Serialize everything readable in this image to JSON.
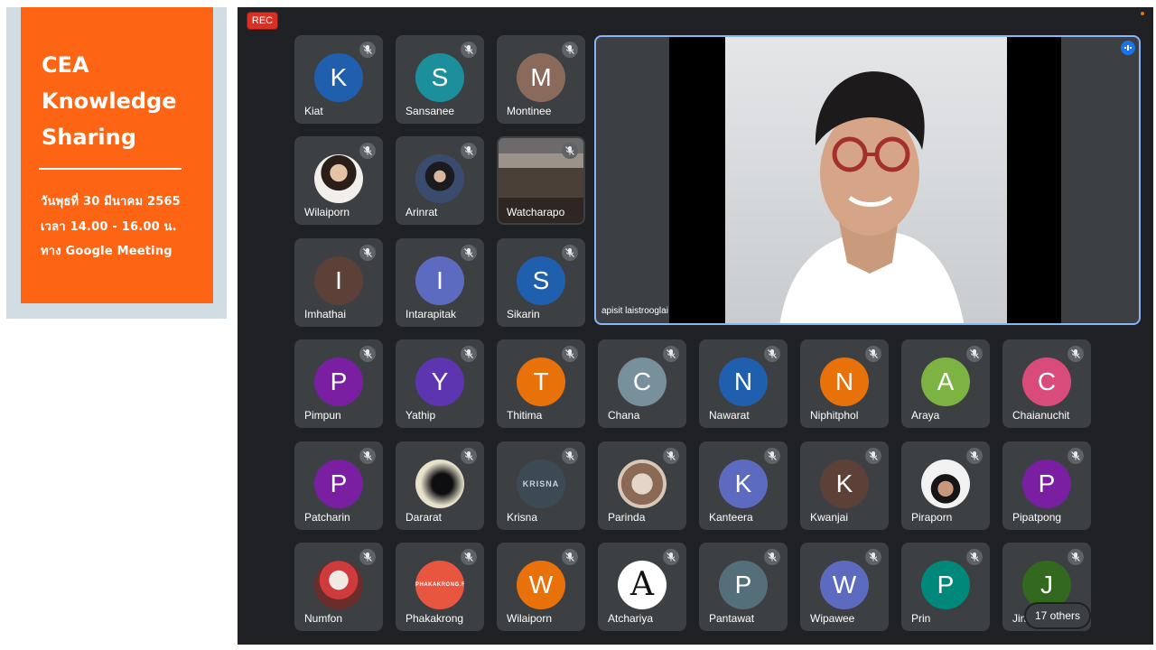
{
  "poster": {
    "title_lines": [
      "CEA",
      "Knowledge",
      "Sharing"
    ],
    "info_lines": [
      "วันพุธที่ 30 มีนาคม 2565",
      "เวลา 14.00 - 16.00 น.",
      "ทาง Google Meeting"
    ],
    "bg_color": "#fd6414"
  },
  "meet": {
    "rec_label": "REC",
    "speaker": {
      "name": "apisit laistrooglai"
    },
    "others_label": "17 others",
    "participants": [
      {
        "name": "Kiat",
        "initial": "K",
        "color": "#1f5fae"
      },
      {
        "name": "Sansanee",
        "initial": "S",
        "color": "#1b8f9c"
      },
      {
        "name": "Montinee",
        "initial": "M",
        "color": "#8a6b5b"
      },
      {
        "name": "Wilaiporn",
        "initial": "",
        "color": "#f2eee9"
      },
      {
        "name": "Arinrat",
        "initial": "",
        "color": "#3a4c6e"
      },
      {
        "name": "Watcharapo",
        "initial": "",
        "color": "#4b4038"
      },
      {
        "name": "Imhathai",
        "initial": "I",
        "color": "#5d4037"
      },
      {
        "name": "Intarapitak",
        "initial": "I",
        "color": "#5c6bc0"
      },
      {
        "name": "Sikarin",
        "initial": "S",
        "color": "#1f5fae"
      },
      {
        "name": "Pimpun",
        "initial": "P",
        "color": "#7b1fa2"
      },
      {
        "name": "Yathip",
        "initial": "Y",
        "color": "#5e35b1"
      },
      {
        "name": "Thitima",
        "initial": "T",
        "color": "#e8710a"
      },
      {
        "name": "Chana",
        "initial": "C",
        "color": "#78909c"
      },
      {
        "name": "Nawarat",
        "initial": "N",
        "color": "#1f5fae"
      },
      {
        "name": "Niphitphol",
        "initial": "N",
        "color": "#e8710a"
      },
      {
        "name": "Araya",
        "initial": "A",
        "color": "#7cb342"
      },
      {
        "name": "Chaianuchit",
        "initial": "C",
        "color": "#d94b7b"
      },
      {
        "name": "Patcharin",
        "initial": "P",
        "color": "#7b1fa2"
      },
      {
        "name": "Dararat",
        "initial": "",
        "color": "#0e0e10"
      },
      {
        "name": "Krisna",
        "initial": "KRISNA",
        "color": "#3c4a54"
      },
      {
        "name": "Parinda",
        "initial": "",
        "color": "#8a6a55"
      },
      {
        "name": "Kanteera",
        "initial": "K",
        "color": "#5c6bc0"
      },
      {
        "name": "Kwanjai",
        "initial": "K",
        "color": "#5d4037"
      },
      {
        "name": "Piraporn",
        "initial": "",
        "color": "#f2f2f2"
      },
      {
        "name": "Pipatpong",
        "initial": "P",
        "color": "#7b1fa2"
      },
      {
        "name": "Numfon",
        "initial": "",
        "color": "#cf3a3d"
      },
      {
        "name": "Phakakrong",
        "initial": "PHAKAKRONG.F",
        "color": "#e9563f"
      },
      {
        "name": "Wilaiporn",
        "initial": "W",
        "color": "#e8710a"
      },
      {
        "name": "Atchariya",
        "initial": "A",
        "color": "#ffffff"
      },
      {
        "name": "Pantawat",
        "initial": "P",
        "color": "#546e7a"
      },
      {
        "name": "Wipawee",
        "initial": "W",
        "color": "#5c6bc0"
      },
      {
        "name": "Prin",
        "initial": "P",
        "color": "#00897b"
      },
      {
        "name": "Jin",
        "initial": "J",
        "color": "#33691e"
      }
    ]
  }
}
